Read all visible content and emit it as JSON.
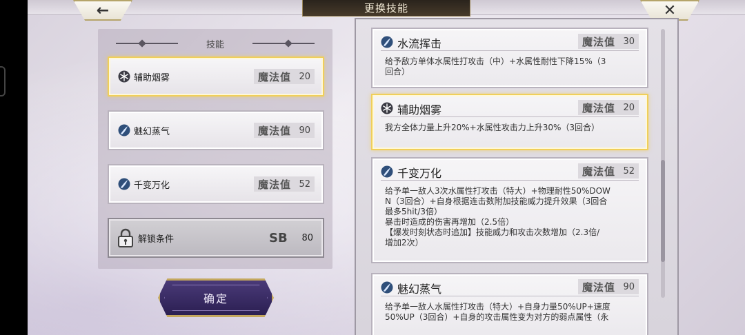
{
  "header": {
    "title": "更换技能",
    "back_icon": "←",
    "close_icon": "✕"
  },
  "left_panel": {
    "heading": "技能",
    "slots": [
      {
        "name": "辅助烟雾",
        "mp_label": "魔法值",
        "mp": "20",
        "icon": "snowflake-icon",
        "selected": true
      },
      {
        "name": "魅幻蒸气",
        "mp_label": "魔法值",
        "mp": "90",
        "icon": "water-icon",
        "selected": false
      },
      {
        "name": "千变万化",
        "mp_label": "魔法值",
        "mp": "52",
        "icon": "water-icon",
        "selected": false
      }
    ],
    "locked_slot": {
      "name": "解锁条件",
      "badge": "SB",
      "value": "80"
    }
  },
  "confirm_label": "确定",
  "skill_list": [
    {
      "name": "水流挥击",
      "mp_label": "魔法值",
      "mp": "30",
      "icon": "water-icon",
      "desc": "给予敌方单体水属性打攻击（中）+水属性耐性下降15%（3\n回合）"
    },
    {
      "name": "辅助烟雾",
      "mp_label": "魔法值",
      "mp": "20",
      "icon": "snowflake-icon",
      "desc": "我方全体力量上升20%+水属性攻击力上升30%（3回合）"
    },
    {
      "name": "千变万化",
      "mp_label": "魔法值",
      "mp": "52",
      "icon": "water-icon",
      "desc": "给予单一敌人3次水属性打攻击（特大）+物理耐性50%DOW\nN（3回合）+自身根据连击数附加技能威力提升效果（3回合\n最多5hit/3倍）\n暴击时造成的伤害再增加（2.5倍）\n【爆发时刻状态时追加】技能威力和攻击次数增加（2.3倍/\n增加2次）"
    },
    {
      "name": "魅幻蒸气",
      "mp_label": "魔法值",
      "mp": "90",
      "icon": "water-icon",
      "desc": "给予单一敌人水属性打攻击（特大）+自身力量50%UP+速度\n50%UP（3回合）+自身的攻击属性变为对方的弱点属性（永"
    }
  ]
}
